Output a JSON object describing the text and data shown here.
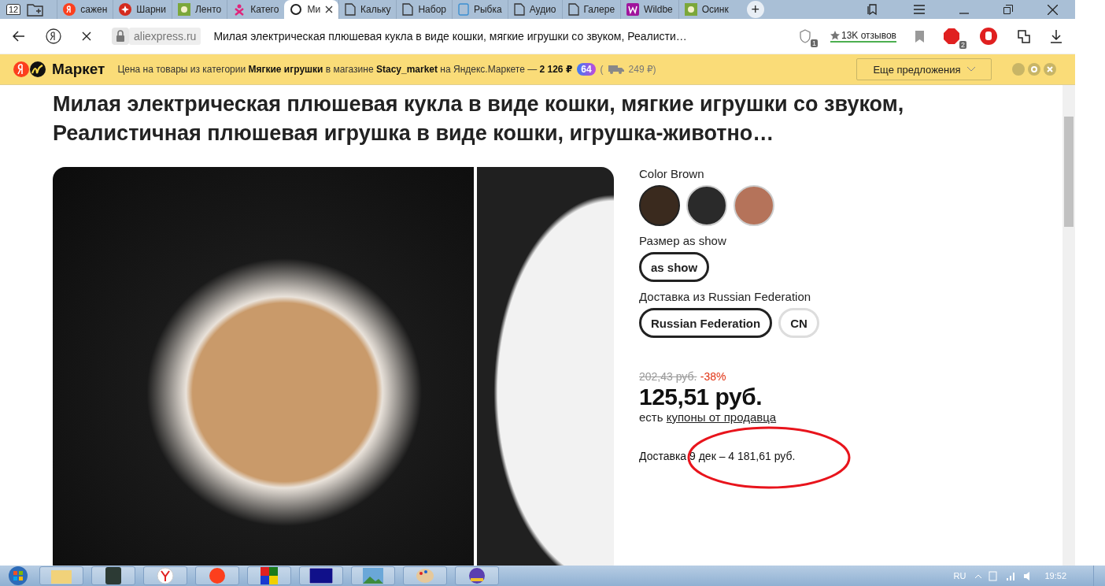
{
  "browser": {
    "tab_count": "12",
    "tabs": [
      {
        "label": "сажен",
        "selected": false,
        "kind": "yandex"
      },
      {
        "label": "Шарни",
        "selected": false,
        "kind": "star"
      },
      {
        "label": "Ленто",
        "selected": false,
        "kind": "flower"
      },
      {
        "label": "Катего",
        "selected": false,
        "kind": "person"
      },
      {
        "label": "Ми",
        "selected": true,
        "kind": "loading"
      },
      {
        "label": "Кальку",
        "selected": false,
        "kind": "page"
      },
      {
        "label": "Набор",
        "selected": false,
        "kind": "page"
      },
      {
        "label": "Рыбка",
        "selected": false,
        "kind": "book"
      },
      {
        "label": "Аудио",
        "selected": false,
        "kind": "page"
      },
      {
        "label": "Галере",
        "selected": false,
        "kind": "page"
      },
      {
        "label": "Wildbe",
        "selected": false,
        "kind": "w"
      },
      {
        "label": "Осинк",
        "selected": false,
        "kind": "flower"
      }
    ],
    "new_tab": "+",
    "address": "aliexpress.ru",
    "page_title": "Милая электрическая плюшевая кукла в виде кошки, мягкие игрушки со звуком, Реалисти…",
    "protect_badge": "1",
    "reviews": "13K отзывов",
    "adblock_badge": "2"
  },
  "market_bar": {
    "logo": "Маркет",
    "message": "Цена на товары из категории **Мягкие игрушки** в магазине **Stacy_market** на Яндекс.Маркете — **2 126 ₽**",
    "plus_badge": "64",
    "delivery_open": "(",
    "delivery": "249 ₽)",
    "button": "Еще предложения"
  },
  "product": {
    "title": "Милая электрическая плюшевая кукла в виде кошки, мягкие игрушки со звуком, Реалистичная плюшевая игрушка в виде кошки, игрушка-животно…",
    "options": [
      {
        "label": "Color Brown",
        "kind": "swatches",
        "items": [
          {
            "selected": true
          },
          {
            "selected": false
          },
          {
            "selected": false
          }
        ]
      },
      {
        "label": "Размер as show",
        "kind": "chips",
        "items": [
          {
            "label": "as show",
            "selected": true
          }
        ]
      },
      {
        "label": "Доставка из Russian Federation",
        "kind": "chips",
        "items": [
          {
            "label": "Russian Federation",
            "selected": true
          },
          {
            "label": "CN",
            "selected": false
          }
        ]
      }
    ],
    "old_price": "202,43 руб.",
    "discount": "-38%",
    "price": "125,51 руб.",
    "coupon_prefix": "есть",
    "coupon_link": "купоны от продавца",
    "delivery": "Доставка 9 дек – 4 181,61 руб."
  },
  "taskbar": {
    "language": "RU",
    "time": "19:52"
  }
}
